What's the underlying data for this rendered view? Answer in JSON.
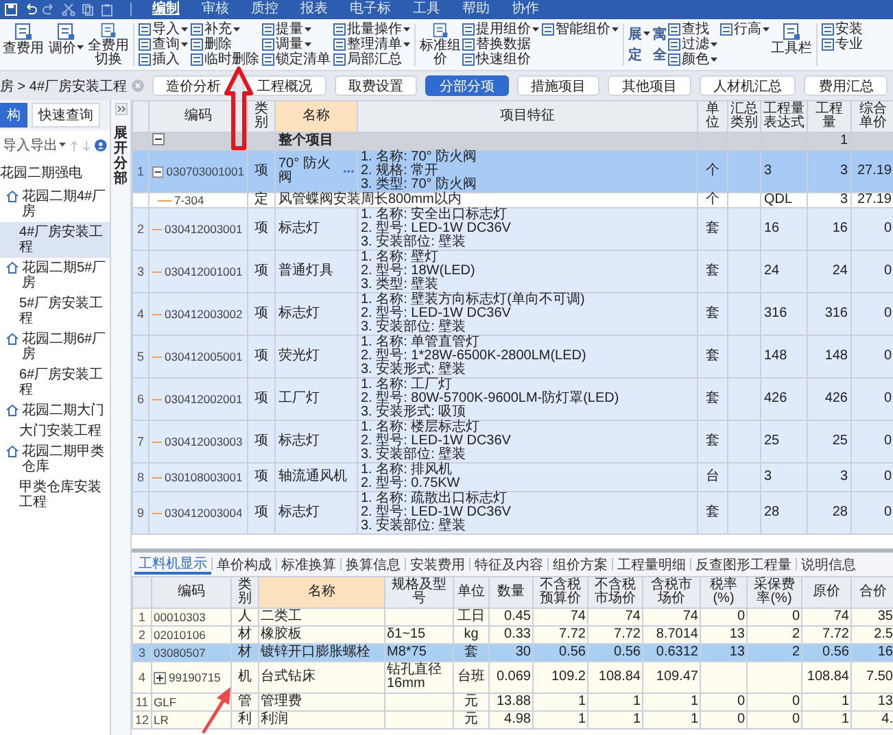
{
  "menu_tabs": [
    {
      "label": "编制",
      "selected": true
    },
    {
      "label": "审核",
      "selected": false
    },
    {
      "label": "质控",
      "selected": false
    },
    {
      "label": "报表",
      "selected": false
    },
    {
      "label": "电子标",
      "selected": false
    },
    {
      "label": "工具",
      "selected": false
    },
    {
      "label": "帮助",
      "selected": false
    },
    {
      "label": "协作",
      "selected": false
    }
  ],
  "ribbon": {
    "groups": [
      {
        "blocks": [
          {
            "kind": "big",
            "items": [
              {
                "label": "查费用",
                "dropdown": false
              },
              {
                "label": "调价",
                "dropdown": true
              },
              {
                "label": "全费用切换",
                "dropdown": false
              }
            ]
          }
        ]
      },
      {
        "blocks": [
          {
            "kind": "small",
            "items": [
              {
                "label": "导入",
                "dropdown": true
              },
              {
                "label": "查询",
                "dropdown": true
              },
              {
                "label": "插入",
                "dropdown": false
              },
              {
                "label": "补充",
                "dropdown": true
              },
              {
                "label": "删除",
                "dropdown": false
              },
              {
                "label": "临时删除",
                "dropdown": false
              },
              {
                "label": "提量",
                "dropdown": true
              },
              {
                "label": "调量",
                "dropdown": true
              },
              {
                "label": "锁定清单",
                "dropdown": false
              },
              {
                "label": "批量操作",
                "dropdown": true
              },
              {
                "label": "整理清单",
                "dropdown": true
              },
              {
                "label": "局部汇总",
                "dropdown": false
              }
            ]
          }
        ]
      },
      {
        "blocks": [
          {
            "kind": "big",
            "items": [
              {
                "label": "标准组价",
                "dropdown": false
              }
            ]
          },
          {
            "kind": "small",
            "items": [
              {
                "label": "提用组价",
                "dropdown": true
              },
              {
                "label": "替换数据",
                "dropdown": false
              },
              {
                "label": "快速组价",
                "dropdown": false
              },
              {
                "label": "智能组价",
                "dropdown": true
              }
            ]
          }
        ]
      },
      {
        "blocks": [
          {
            "kind": "glyph",
            "items": [
              {
                "label": "展",
                "dropdown": true
              },
              {
                "label": "定",
                "dropdown": false
              },
              {
                "label": "寓",
                "dropdown": false
              },
              {
                "label": "全",
                "dropdown": false
              }
            ]
          },
          {
            "kind": "small",
            "items": [
              {
                "label": "查找",
                "dropdown": false
              },
              {
                "label": "过滤",
                "dropdown": true
              },
              {
                "label": "颜色",
                "dropdown": true
              },
              {
                "label": "行高",
                "dropdown": true
              }
            ]
          },
          {
            "kind": "big",
            "items": [
              {
                "label": "工具栏",
                "dropdown": false
              }
            ]
          }
        ]
      },
      {
        "blocks": [
          {
            "kind": "small",
            "items": [
              {
                "label": "安装",
                "dropdown": false
              },
              {
                "label": "专业",
                "dropdown": false
              }
            ]
          }
        ]
      }
    ]
  },
  "breadcrumb": "房 > 4#厂房安装工程",
  "view_tabs": [
    {
      "label": "造价分析",
      "selected": false
    },
    {
      "label": "工程概况",
      "selected": false
    },
    {
      "label": "取费设置",
      "selected": false
    },
    {
      "label": "分部分项",
      "selected": true
    },
    {
      "label": "措施项目",
      "selected": false
    },
    {
      "label": "其他项目",
      "selected": false
    },
    {
      "label": "人材机汇总",
      "selected": false
    },
    {
      "label": "费用汇总",
      "selected": false
    }
  ],
  "left_panel": {
    "tabs": [
      {
        "label": "构",
        "selected": true
      },
      {
        "label": "快速查询",
        "selected": false
      }
    ],
    "tool": "导入导出",
    "tree": {
      "label": "花园二期强电",
      "children": [
        {
          "label": "花园二期4#厂房",
          "selected": false,
          "children": [
            {
              "label": "4#厂房安装工程",
              "selected": true
            }
          ]
        },
        {
          "label": "花园二期5#厂房",
          "selected": false,
          "children": [
            {
              "label": "5#厂房安装工程",
              "selected": false
            }
          ]
        },
        {
          "label": "花园二期6#厂房",
          "selected": false,
          "children": [
            {
              "label": "6#厂房安装工程",
              "selected": false
            }
          ]
        },
        {
          "label": "花园二期大门",
          "selected": false,
          "children": [
            {
              "label": "大门安装工程",
              "selected": false
            }
          ]
        },
        {
          "label": "花园二期甲类仓库",
          "selected": false,
          "children": [
            {
              "label": "甲类仓库安装工程",
              "selected": false
            }
          ]
        }
      ]
    }
  },
  "side_strip": {
    "label": "展开分部"
  },
  "top_table": {
    "columns": [
      "编码",
      "类别",
      "名称",
      "项目特征",
      "单位",
      "汇总类别",
      "工程量表达式",
      "工程量",
      "综合单价"
    ],
    "rows": [
      {
        "kind": "section",
        "expanded": true,
        "name": "整个项目",
        "qty": "1"
      },
      {
        "kind": "item",
        "selected": true,
        "num": "1",
        "code": "030703001001",
        "expanded": true,
        "type": "项",
        "name": "70° 防火阀",
        "features": "1. 名称: 70° 防火阀\n2. 规格: 常开\n3. 类型: 70° 防火阀",
        "unit": "个",
        "expr": "3",
        "qty": "3",
        "price": "27.19"
      },
      {
        "kind": "sub",
        "selected": false,
        "code": "7-304",
        "type": "定",
        "name": "风管蝶阀安装周长800mm以内",
        "unit": "个",
        "expr": "QDL",
        "qty": "3",
        "price": "27.19"
      },
      {
        "kind": "item",
        "selected": false,
        "num": "2",
        "code": "030412003001",
        "type": "项",
        "name": "标志灯",
        "features": "1. 名称: 安全出口标志灯\n2. 型号: LED-1W  DC36V\n3. 安装部位: 壁装",
        "unit": "套",
        "expr": "16",
        "qty": "16",
        "price": "0"
      },
      {
        "kind": "item",
        "selected": false,
        "num": "3",
        "code": "030412001001",
        "type": "项",
        "name": "普通灯具",
        "features": "1. 名称: 壁灯\n2. 型号: 18W(LED)\n3. 类型: 壁装",
        "unit": "套",
        "expr": "24",
        "qty": "24",
        "price": "0"
      },
      {
        "kind": "item",
        "selected": false,
        "num": "4",
        "code": "030412003002",
        "type": "项",
        "name": "标志灯",
        "features": "1. 名称: 壁装方向标志灯(单向不可调)\n2. 型号: LED-1W  DC36V\n3. 安装部位: 壁装",
        "unit": "套",
        "expr": "316",
        "qty": "316",
        "price": "0"
      },
      {
        "kind": "item",
        "selected": false,
        "num": "5",
        "code": "030412005001",
        "type": "项",
        "name": "荧光灯",
        "features": "1. 名称: 单管直管灯\n2. 型号: 1*28W-6500K-2800LM(LED)\n3. 安装形式: 壁装",
        "unit": "套",
        "expr": "148",
        "qty": "148",
        "price": "0"
      },
      {
        "kind": "item",
        "selected": false,
        "num": "6",
        "code": "030412002001",
        "type": "项",
        "name": "工厂灯",
        "features": "1. 名称: 工厂灯\n2. 型号: 80W-5700K-9600LM-防灯罩(LED)\n3. 安装形式: 吸顶",
        "unit": "套",
        "expr": "426",
        "qty": "426",
        "price": "0"
      },
      {
        "kind": "item",
        "selected": false,
        "num": "7",
        "code": "030412003003",
        "type": "项",
        "name": "标志灯",
        "features": "1. 名称: 楼层标志灯\n2. 型号: LED-1W  DC36V\n3. 安装部位: 壁装",
        "unit": "套",
        "expr": "25",
        "qty": "25",
        "price": "0"
      },
      {
        "kind": "item",
        "selected": false,
        "num": "8",
        "code": "030108003001",
        "type": "项",
        "name": "轴流通风机",
        "features": "1. 名称: 排风机\n2. 型号: 0.75KW",
        "unit": "台",
        "expr": "3",
        "qty": "3",
        "price": "0"
      },
      {
        "kind": "item",
        "selected": false,
        "num": "9",
        "code": "030412003004",
        "type": "项",
        "name": "标志灯",
        "features": "1. 名称: 疏散出口标志灯\n2. 型号: LED-1W  DC36V\n3. 安装部位: 壁装",
        "unit": "套",
        "expr": "28",
        "qty": "28",
        "price": "0"
      }
    ]
  },
  "bottom_tabs": [
    {
      "label": "工料机显示",
      "selected": true
    },
    {
      "label": "单价构成",
      "selected": false
    },
    {
      "label": "标准换算",
      "selected": false
    },
    {
      "label": "换算信息",
      "selected": false
    },
    {
      "label": "安装费用",
      "selected": false
    },
    {
      "label": "特征及内容",
      "selected": false
    },
    {
      "label": "组价方案",
      "selected": false
    },
    {
      "label": "工程量明细",
      "selected": false
    },
    {
      "label": "反查图形工程量",
      "selected": false
    },
    {
      "label": "说明信息",
      "selected": false
    }
  ],
  "bottom_table": {
    "columns": [
      "编码",
      "类别",
      "名称",
      "规格及型号",
      "单位",
      "数量",
      "不含税预算价",
      "不含税市场价",
      "含税市场价",
      "税率(%)",
      "采保费率(%)",
      "原价",
      "合价"
    ],
    "rows": [
      {
        "num": "1",
        "selected": false,
        "code": "00010303",
        "type": "人",
        "name": "二类工",
        "unit": "工日",
        "qty": "0.45",
        "p_budget": "74",
        "p_market": "74",
        "p_tax": "74",
        "tax_rate": "0",
        "fee_rate": "0",
        "orig": "74",
        "total": "35"
      },
      {
        "num": "2",
        "selected": false,
        "code": "02010106",
        "type": "材",
        "name": "橡胶板",
        "spec": "δ1~15",
        "unit": "kg",
        "qty": "0.33",
        "p_budget": "7.72",
        "p_market": "7.72",
        "p_tax": "8.7014",
        "tax_rate": "13",
        "fee_rate": "2",
        "orig": "7.72",
        "total": "2.5"
      },
      {
        "num": "3",
        "selected": true,
        "code": "03080507",
        "type": "材",
        "name": "镀锌开口膨胀螺栓",
        "spec": "M8*75",
        "unit": "套",
        "qty": "30",
        "p_budget": "0.56",
        "p_market": "0.56",
        "p_tax": "0.6312",
        "tax_rate": "13",
        "fee_rate": "2",
        "orig": "0.56",
        "total": "16"
      },
      {
        "num": "4",
        "selected": false,
        "expanded": false,
        "code": "99190715",
        "type": "机",
        "name": "台式钻床",
        "spec": "钻孔直径16mm",
        "unit": "台班",
        "qty": "0.069",
        "p_budget": "109.2",
        "p_market": "108.84",
        "p_tax": "109.47",
        "orig": "108.84",
        "total": "7.50"
      },
      {
        "num": "11",
        "selected": false,
        "code": "GLF",
        "type": "管",
        "name": "管理费",
        "unit": "元",
        "qty": "13.88",
        "p_budget": "1",
        "p_market": "1",
        "p_tax": "1",
        "tax_rate": "0",
        "fee_rate": "0",
        "orig": "1",
        "total": "13"
      },
      {
        "num": "12",
        "selected": false,
        "code": "LR",
        "type": "利",
        "name": "利润",
        "unit": "元",
        "qty": "4.98",
        "p_budget": "1",
        "p_market": "1",
        "p_tax": "1",
        "tax_rate": "0",
        "fee_rate": "0",
        "orig": "1",
        "total": "4."
      }
    ]
  }
}
